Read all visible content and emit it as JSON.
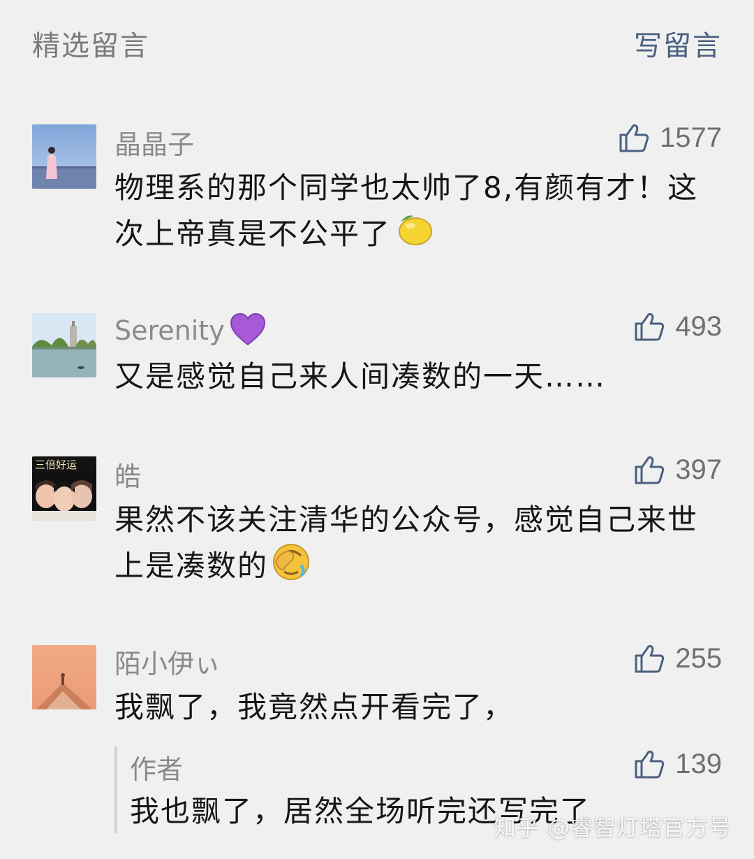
{
  "header": {
    "title": "精选留言",
    "write_label": "写留言"
  },
  "comments": [
    {
      "author": "晶晶子",
      "likes": "1577",
      "text": "物理系的那个同学也太帅了8,有颜有才！这次上帝真是不公平了",
      "emoji": "lemon-emoji"
    },
    {
      "author": "Serenity",
      "author_emoji": "purple-heart-emoji",
      "likes": "493",
      "text": "又是感觉自己来人间凑数的一天……"
    },
    {
      "author": "皓",
      "avatar_text": "三倍好运",
      "likes": "397",
      "text": "果然不该关注清华的公众号，感觉自己来世上是凑数的",
      "emoji": "face-palm-emoji"
    },
    {
      "author": "陌小伊ぃ",
      "likes": "255",
      "text": "我飘了，我竟然点开看完了，",
      "reply": {
        "author": "作者",
        "likes": "139",
        "text": "我也飘了，居然全场听完还写完了"
      }
    }
  ],
  "watermark": "知乎 @睿智灯塔官方号",
  "colors": {
    "background": "#f0f0f0",
    "link": "#4b5f7f",
    "meta": "#8a8a8a",
    "text": "#161616"
  }
}
